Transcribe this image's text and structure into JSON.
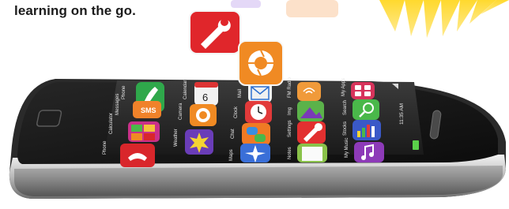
{
  "tagline": "learning on the go.",
  "status_bar": {
    "time": "11:35 AM"
  },
  "dock": [
    {
      "label": "Phone",
      "icon": "phone-icon",
      "color": "#2fa84b"
    },
    {
      "label": "Messages",
      "icon": "sms-icon",
      "color": "#f0822a"
    },
    {
      "label": "Calculator",
      "icon": "calculator-icon",
      "color": "#c9308a"
    },
    {
      "label": "Phone",
      "icon": "hangup-icon",
      "color": "#d9262b"
    }
  ],
  "apps": [
    {
      "label": "Calendar",
      "icon": "calendar-icon",
      "color": "#f2f2f2",
      "text": "6"
    },
    {
      "label": "Camera",
      "icon": "aperture-icon",
      "color": "#f08a23"
    },
    {
      "label": "Weather",
      "icon": "sun-icon",
      "color": "#6a3db8"
    },
    {
      "label": "Mail",
      "icon": "envelope-icon",
      "color": "#f0f0f0"
    },
    {
      "label": "Clock",
      "icon": "clock-icon",
      "color": "#e23a3a"
    },
    {
      "label": "Chat",
      "icon": "chat-icon",
      "color": "#f07a24"
    },
    {
      "label": "Maps",
      "icon": "compass-icon",
      "color": "#3a6fd8"
    },
    {
      "label": "FM Radio",
      "icon": "radio-icon",
      "color": "#f09a3a"
    },
    {
      "label": "Img",
      "icon": "image-icon",
      "color": "#5bb24a"
    },
    {
      "label": "Settings",
      "icon": "wrench-icon",
      "color": "#e23030"
    },
    {
      "label": "Notes",
      "icon": "notes-icon",
      "color": "#8ac24a"
    },
    {
      "label": "My Apps",
      "icon": "apps-icon",
      "color": "#d7335b"
    },
    {
      "label": "Search",
      "icon": "search-icon",
      "color": "#4ab84a"
    },
    {
      "label": "Stocks",
      "icon": "chart-icon",
      "color": "#3a59c8"
    },
    {
      "label": "My Music",
      "icon": "music-icon",
      "color": "#8d3ab8"
    }
  ],
  "floating_icons": [
    {
      "icon": "wrench-icon",
      "color": "#e0262b"
    },
    {
      "icon": "aperture-icon",
      "color": "#f08a23"
    }
  ]
}
